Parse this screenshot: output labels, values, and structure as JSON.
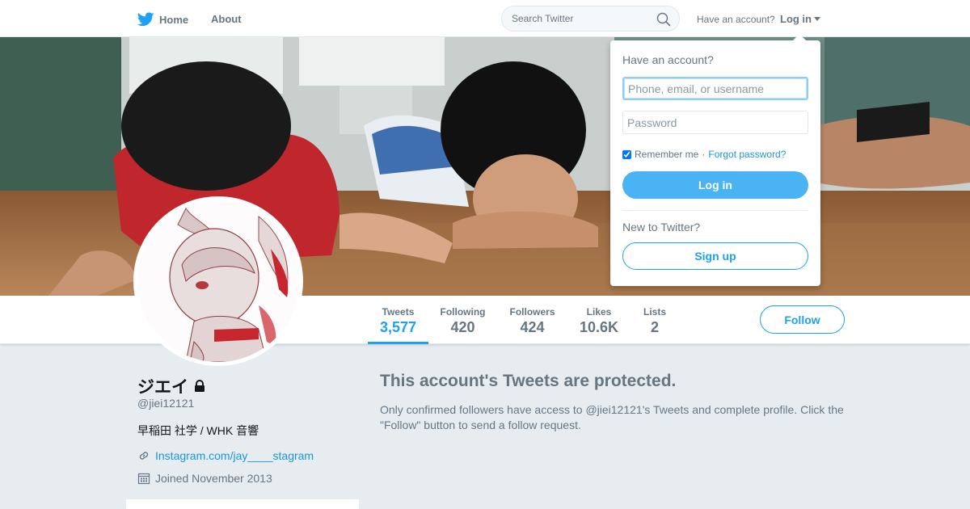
{
  "nav": {
    "home_label": "Home",
    "about_label": "About",
    "search_placeholder": "Search Twitter",
    "have_account": "Have an account?",
    "login_label": "Log in"
  },
  "profile": {
    "name": "ジエイ",
    "handle": "@jiei12121",
    "bio": "早稲田 社学 / WHK 音響",
    "link": "Instagram.com/jay____stagram",
    "joined": "Joined November 2013",
    "protected": true
  },
  "stats": [
    {
      "label": "Tweets",
      "value": "3,577",
      "active": true
    },
    {
      "label": "Following",
      "value": "420",
      "active": false
    },
    {
      "label": "Followers",
      "value": "424",
      "active": false
    },
    {
      "label": "Likes",
      "value": "10.6K",
      "active": false
    },
    {
      "label": "Lists",
      "value": "2",
      "active": false
    }
  ],
  "follow_label": "Follow",
  "protected_notice": {
    "title": "This account's Tweets are protected.",
    "text": "Only confirmed followers have access to @jiei12121's Tweets and complete profile. Click the \"Follow\" button to send a follow request."
  },
  "login_dropdown": {
    "heading": "Have an account?",
    "username_placeholder": "Phone, email, or username",
    "password_placeholder": "Password",
    "remember_label": "Remember me",
    "remember_checked": true,
    "separator": "·",
    "forgot_label": "Forgot password?",
    "login_button": "Log in",
    "new_to": "New to Twitter?",
    "signup_button": "Sign up"
  },
  "colors": {
    "accent": "#1da1f2",
    "page_bg": "#e6ecf0",
    "login_button": "#4ab3f4"
  },
  "icons": {
    "brand": "twitter-bird-icon",
    "search": "search-icon",
    "dropdown": "caret-down-icon",
    "lock": "lock-icon",
    "link": "link-icon",
    "calendar": "calendar-icon"
  }
}
